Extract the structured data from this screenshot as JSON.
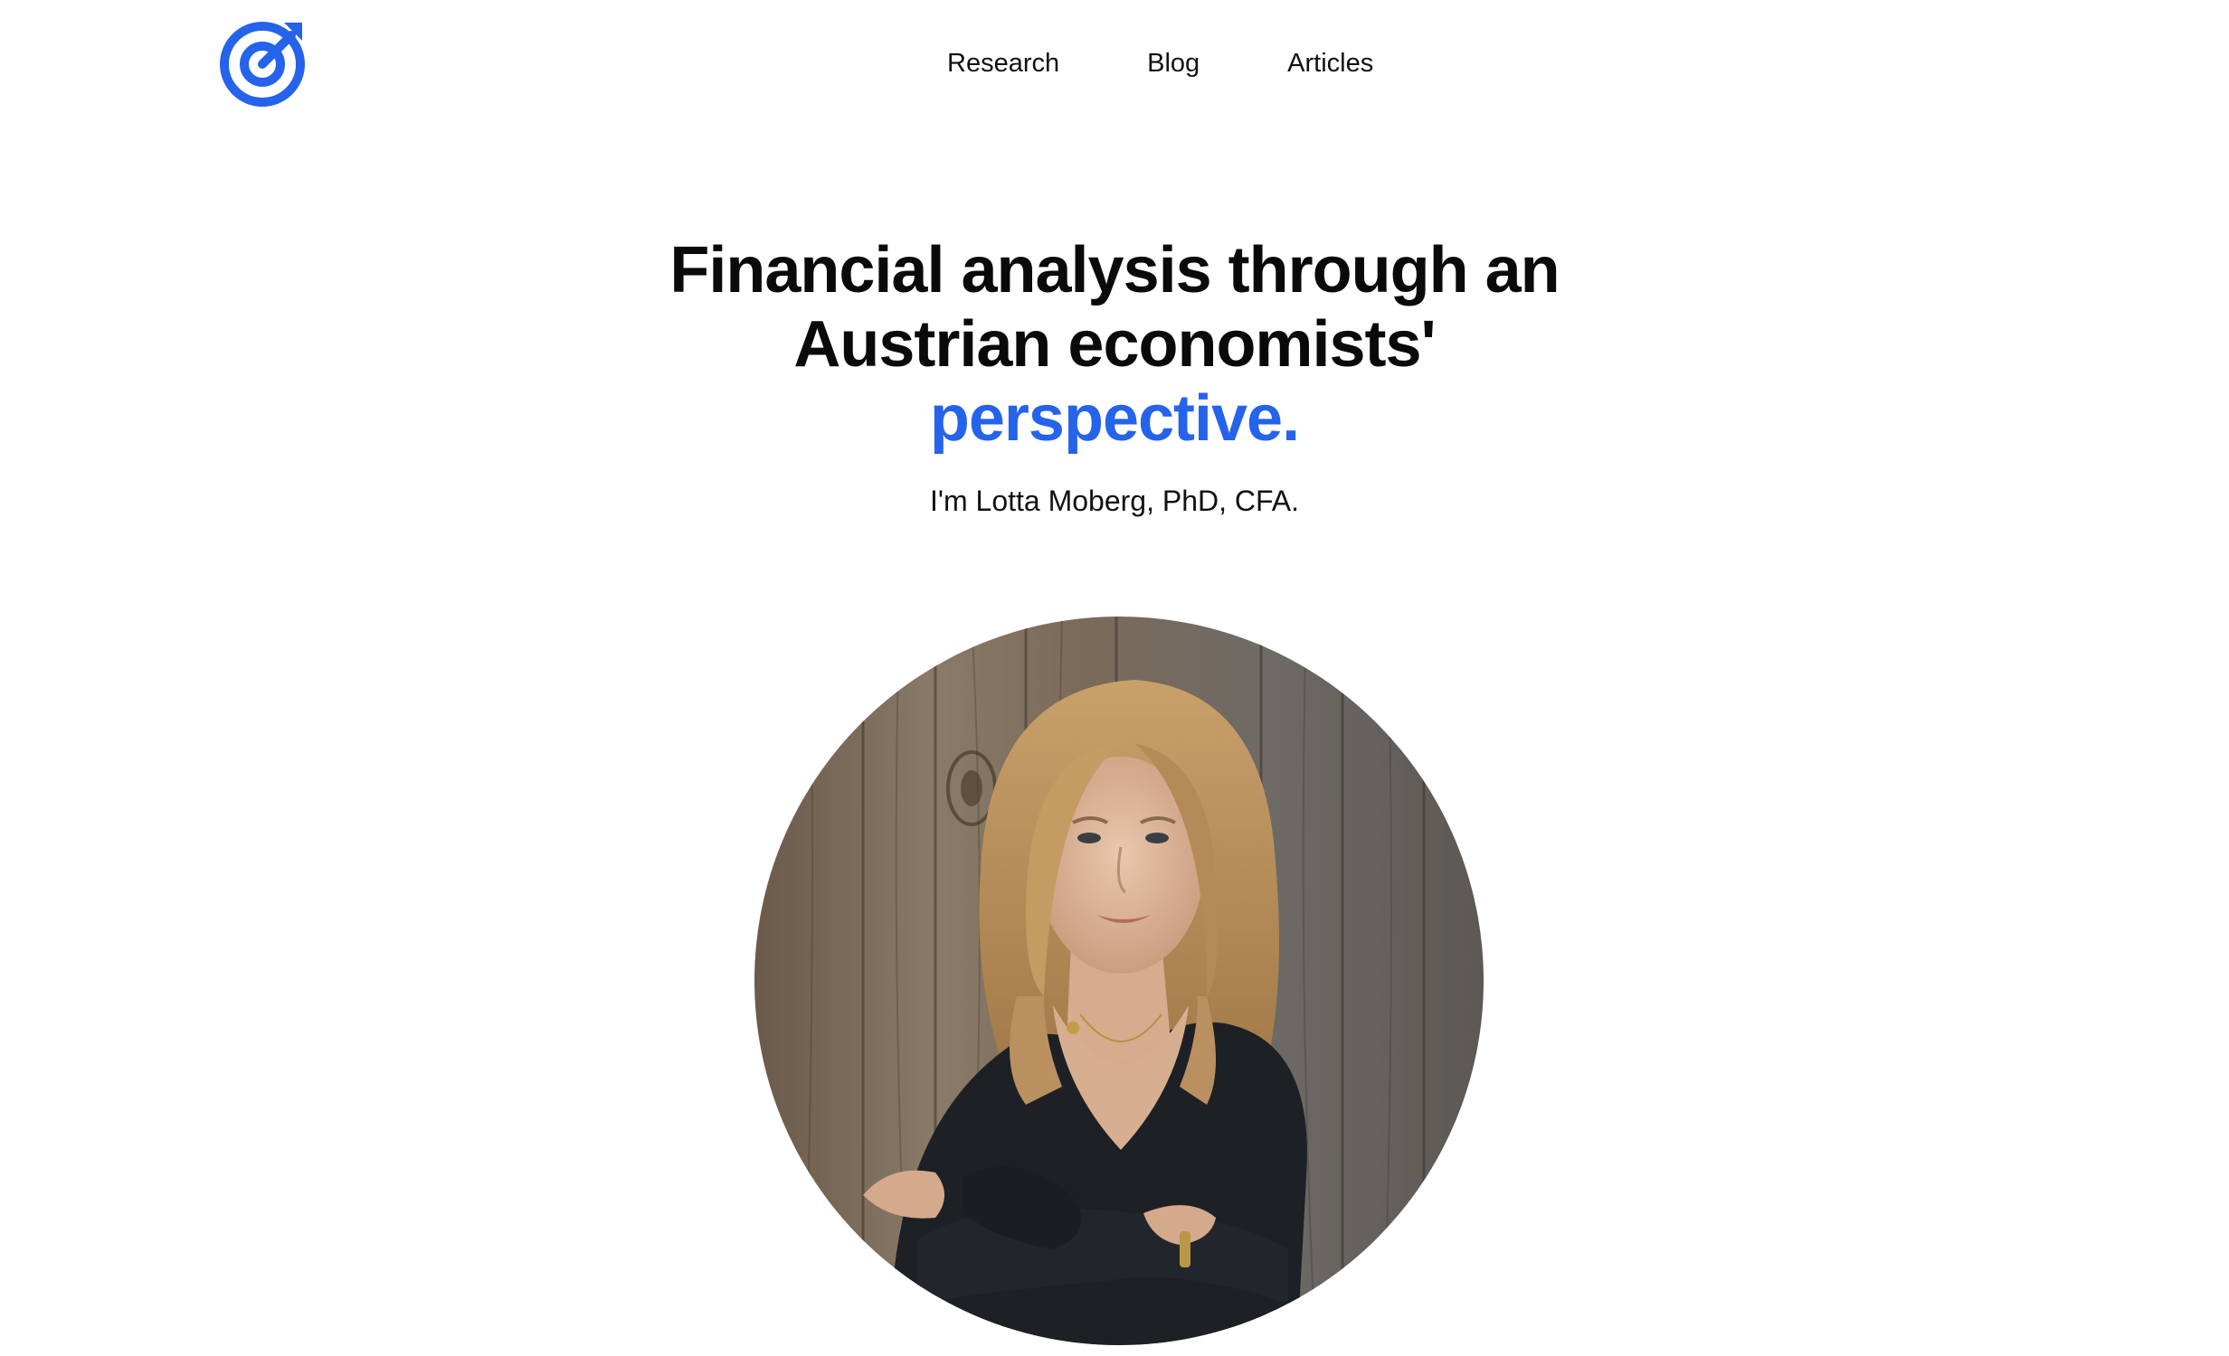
{
  "header": {
    "logo_icon": "target-arrow-logo-icon",
    "nav": [
      {
        "label": "Research"
      },
      {
        "label": "Blog"
      },
      {
        "label": "Articles"
      }
    ]
  },
  "hero": {
    "title_line_1": "Financial analysis through an",
    "title_line_2": "Austrian economists'",
    "title_accent": "perspective.",
    "subtitle": "I'm Lotta Moberg, PhD, CFA."
  },
  "portrait": {
    "icon": "person-portrait-photo"
  },
  "colors": {
    "accent": "#2563eb",
    "text": "#0a0a0a",
    "background": "#ffffff"
  }
}
